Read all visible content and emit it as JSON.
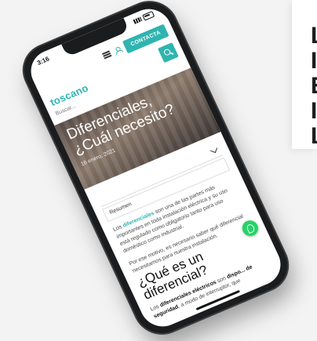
{
  "status": {
    "time": "3:16"
  },
  "topbar": {
    "contact_label": "CONTACTA"
  },
  "brand": {
    "logo_text": "toscano"
  },
  "search": {
    "placeholder": "Buscar..."
  },
  "hero": {
    "title": "Diferenciales, ¿Cuál necesito?",
    "date": "16 enero, 2021"
  },
  "summary": {
    "label": "Resumen"
  },
  "body": {
    "p1_pre": "Los ",
    "p1_link": "diferenciales",
    "p1_post": " son una de las partes más importantes en toda instalación eléctrica y su uso está regulado como obligatorio tanto para uso doméstico como industrial.",
    "p2": "Por ese motivo, es necesario saber qué diferencial necesitamos para nuestra instalación."
  },
  "section": {
    "heading": "¿Qué es un diferencial?"
  },
  "lede": {
    "pre": "Los ",
    "bold1": "diferenciales eléctricos",
    "mid": " son ",
    "bold2": "dispo... de seguridad",
    "post": ", a modo de interruptor, que"
  },
  "bg": {
    "heading_fragment": "L\nI\nE\nI\nL"
  },
  "colors": {
    "accent": "#2fb4b0",
    "whatsapp": "#25d366"
  },
  "icons": [
    "hamburger-icon",
    "user-icon",
    "search-icon",
    "chevron-down-icon",
    "whatsapp-icon"
  ]
}
